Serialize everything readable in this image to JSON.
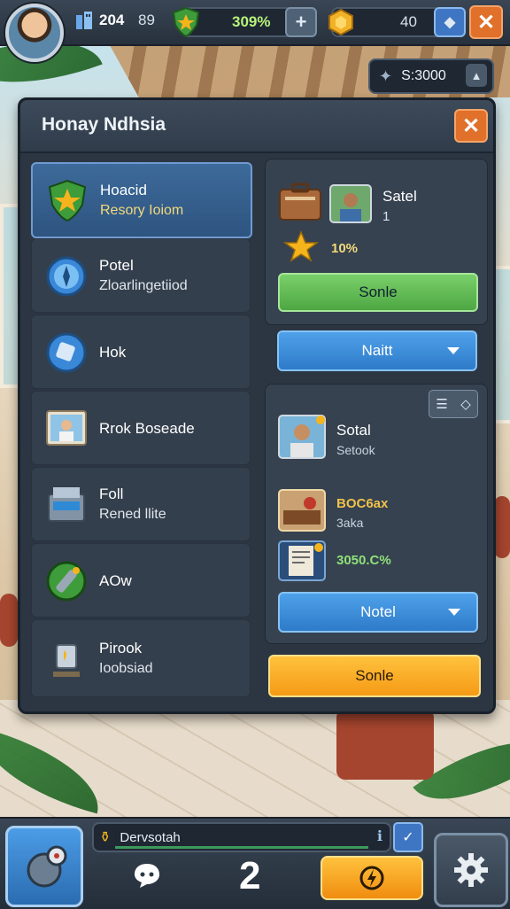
{
  "hud": {
    "stat1": "204",
    "stat2": "89",
    "progress": "309%",
    "gems": "40",
    "cash": "S:3000"
  },
  "panel": {
    "title": "Honay Ndhsia",
    "list": [
      {
        "title": "Hoacid",
        "sub": "Resory Ioiom",
        "icon": "shield-star-icon"
      },
      {
        "title": "Potel",
        "sub": "Zloarlingetiiod",
        "icon": "compass-icon"
      },
      {
        "title": "Hok",
        "sub": "",
        "icon": "gem-tag-icon"
      },
      {
        "title": "Rrok Boseade",
        "sub": "",
        "icon": "portrait-icon"
      },
      {
        "title": "Foll",
        "sub": "Rened llite",
        "icon": "register-icon"
      },
      {
        "title": "AOw",
        "sub": "",
        "icon": "wrench-icon"
      },
      {
        "title": "Pirook",
        "sub": "Ioobsiad",
        "icon": "trophy-icon"
      }
    ],
    "top_card": {
      "name": "Satel",
      "count": "1",
      "bonus": "10%",
      "btn_primary": "Sonle",
      "dropdown": "Naitt"
    },
    "bottom_card": {
      "staff_name": "Sotal",
      "staff_role": "Setook",
      "item_title": "BOC6ax",
      "item_sub": "3aka",
      "item_value": "3050.C%",
      "dropdown": "Notel"
    },
    "action_button": "Sonle"
  },
  "bottom_bar": {
    "label": "Dervsotah",
    "count": "2"
  },
  "colors": {
    "panel": "#2c3643",
    "accent_blue": "#2e7bc9",
    "accent_green": "#4ea744",
    "accent_orange": "#f59a15",
    "gold": "#f4d97a"
  }
}
